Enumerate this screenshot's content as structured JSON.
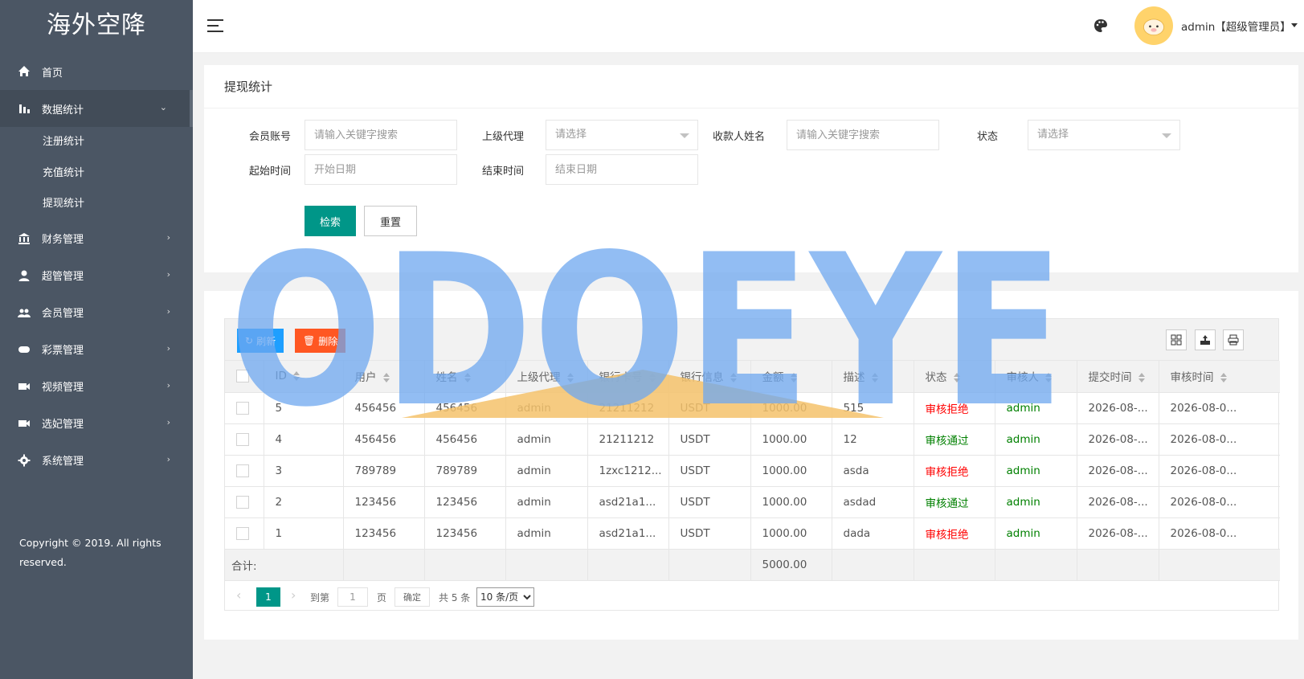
{
  "sidebar": {
    "logo": "海外空降",
    "items": [
      {
        "label": "首页",
        "icon": "home-icon",
        "arrow": ""
      },
      {
        "label": "数据统计",
        "icon": "bar-chart-icon",
        "arrow": "⌄"
      },
      {
        "label": "财务管理",
        "icon": "bank-icon",
        "arrow": "›"
      },
      {
        "label": "超管管理",
        "icon": "user-icon",
        "arrow": "›"
      },
      {
        "label": "会员管理",
        "icon": "users-icon",
        "arrow": "›"
      },
      {
        "label": "彩票管理",
        "icon": "gamepad-icon",
        "arrow": "›"
      },
      {
        "label": "视频管理",
        "icon": "video-icon",
        "arrow": "›"
      },
      {
        "label": "选妃管理",
        "icon": "video-icon",
        "arrow": "›"
      },
      {
        "label": "系统管理",
        "icon": "gear-icon",
        "arrow": "›"
      }
    ],
    "subitems": [
      "注册统计",
      "充值统计",
      "提现统计"
    ],
    "copyright": "Copyright © 2019. All rights reserved."
  },
  "header": {
    "user": "admin【超级管理员】"
  },
  "search": {
    "title": "提现统计",
    "member_label": "会员账号",
    "member_placeholder": "请输入关键字搜索",
    "agent_label": "上级代理",
    "agent_value": "请选择",
    "payee_label": "收款人姓名",
    "payee_placeholder": "请输入关键字搜索",
    "status_label": "状态",
    "status_value": "请选择",
    "start_label": "起始时间",
    "start_placeholder": "开始日期",
    "end_label": "结束时间",
    "end_placeholder": "结束日期",
    "search_button": "检索",
    "reset_button": "重置"
  },
  "table": {
    "refresh": "刷新",
    "delete": "删除",
    "columns": [
      "ID",
      "用户",
      "姓名",
      "上级代理",
      "银行卡号",
      "银行信息",
      "金额",
      "描述",
      "状态",
      "审核人",
      "提交时间",
      "审核时间"
    ],
    "rows": [
      {
        "id": "5",
        "user": "456456",
        "name": "456456",
        "agent": "admin",
        "card": "21211212",
        "bank": "USDT",
        "amount": "1000.00",
        "desc": "515",
        "status": "审核拒绝",
        "auditor": "admin",
        "submit": "2026-08-...",
        "audit": "2026-08-0..."
      },
      {
        "id": "4",
        "user": "456456",
        "name": "456456",
        "agent": "admin",
        "card": "21211212",
        "bank": "USDT",
        "amount": "1000.00",
        "desc": "12",
        "status": "审核通过",
        "auditor": "admin",
        "submit": "2026-08-...",
        "audit": "2026-08-0..."
      },
      {
        "id": "3",
        "user": "789789",
        "name": "789789",
        "agent": "admin",
        "card": "1zxc1212...",
        "bank": "USDT",
        "amount": "1000.00",
        "desc": "asda",
        "status": "审核拒绝",
        "auditor": "admin",
        "submit": "2026-08-...",
        "audit": "2026-08-0..."
      },
      {
        "id": "2",
        "user": "123456",
        "name": "123456",
        "agent": "admin",
        "card": "asd21a1...",
        "bank": "USDT",
        "amount": "1000.00",
        "desc": "asdad",
        "status": "审核通过",
        "auditor": "admin",
        "submit": "2026-08-...",
        "audit": "2026-08-0..."
      },
      {
        "id": "1",
        "user": "123456",
        "name": "123456",
        "agent": "admin",
        "card": "asd21a1...",
        "bank": "USDT",
        "amount": "1000.00",
        "desc": "dada",
        "status": "审核拒绝",
        "auditor": "admin",
        "submit": "2026-08-...",
        "audit": "2026-08-0..."
      }
    ],
    "total_label": "合计:",
    "total_amount": "5000.00"
  },
  "pager": {
    "current": "1",
    "goto": "到第",
    "input": "1",
    "page": "页",
    "confirm": "确定",
    "total": "共 5 条",
    "size": "10 条/页"
  },
  "watermark": "ODOEYE",
  "colors": {
    "sidebar": "#4b5664",
    "primary": "#009688",
    "refresh": "#1e9fff",
    "delete": "#ff5722",
    "reject": "#ff0000",
    "pass": "#008000",
    "watermark": "#6ea8f0"
  }
}
